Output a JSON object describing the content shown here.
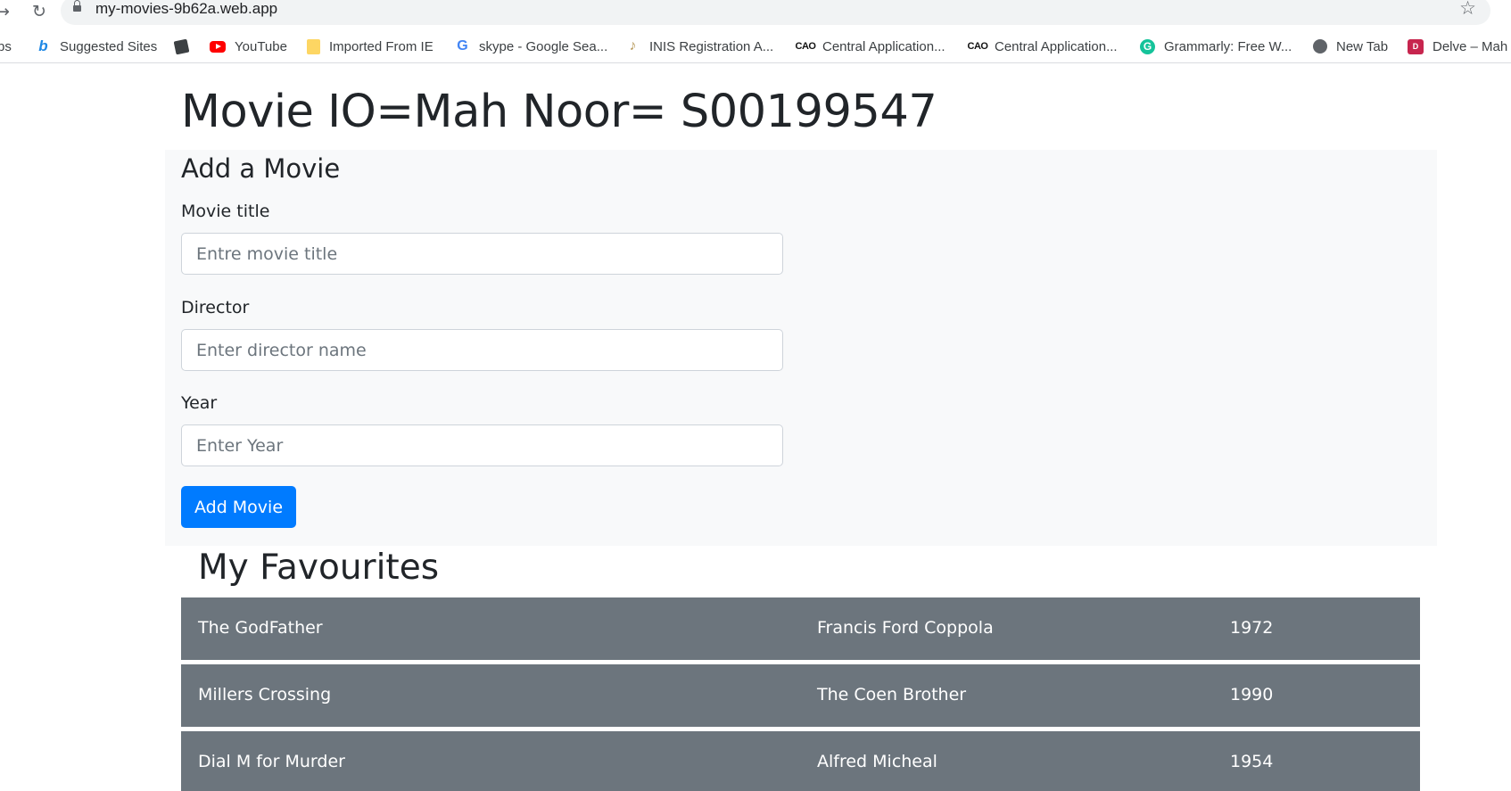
{
  "browser": {
    "url": "my-movies-9b62a.web.app",
    "bookmarks": [
      {
        "label": "ps",
        "icon": "apps-grid-icon"
      },
      {
        "label": "Suggested Sites",
        "icon": "bing-icon"
      },
      {
        "label": "",
        "icon": "cube-icon"
      },
      {
        "label": "YouTube",
        "icon": "youtube-icon"
      },
      {
        "label": "Imported From IE",
        "icon": "folder-icon"
      },
      {
        "label": "skype - Google Sea...",
        "icon": "google-icon"
      },
      {
        "label": "INIS Registration A...",
        "icon": "harp-icon"
      },
      {
        "label": "Central Application...",
        "icon": "cao-icon"
      },
      {
        "label": "Central Application...",
        "icon": "cao-icon"
      },
      {
        "label": "Grammarly: Free W...",
        "icon": "grammarly-icon"
      },
      {
        "label": "New Tab",
        "icon": "globe-icon"
      },
      {
        "label": "Delve – Mah",
        "icon": "delve-icon"
      }
    ],
    "cao_text": "CAO",
    "grammarly_text": "G",
    "google_text": "G",
    "delve_text": "D"
  },
  "page": {
    "title": "Movie IO=Mah Noor= S00199547",
    "form": {
      "heading": "Add a Movie",
      "title_label": "Movie title",
      "title_placeholder": "Entre movie title",
      "director_label": "Director",
      "director_placeholder": "Enter director name",
      "year_label": "Year",
      "year_placeholder": "Enter Year",
      "submit_label": "Add Movie"
    },
    "favourites": {
      "heading": "My Favourites",
      "movies": [
        {
          "title": "The GodFather",
          "director": "Francis Ford Coppola",
          "year": "1972"
        },
        {
          "title": "Millers Crossing",
          "director": "The Coen Brother",
          "year": "1990"
        },
        {
          "title": "Dial M for Murder",
          "director": "Alfred Micheal",
          "year": "1954"
        }
      ]
    }
  },
  "colors": {
    "primary": "#007bff",
    "row_bg": "#6c757d",
    "panel_bg": "#f8f9fa"
  }
}
